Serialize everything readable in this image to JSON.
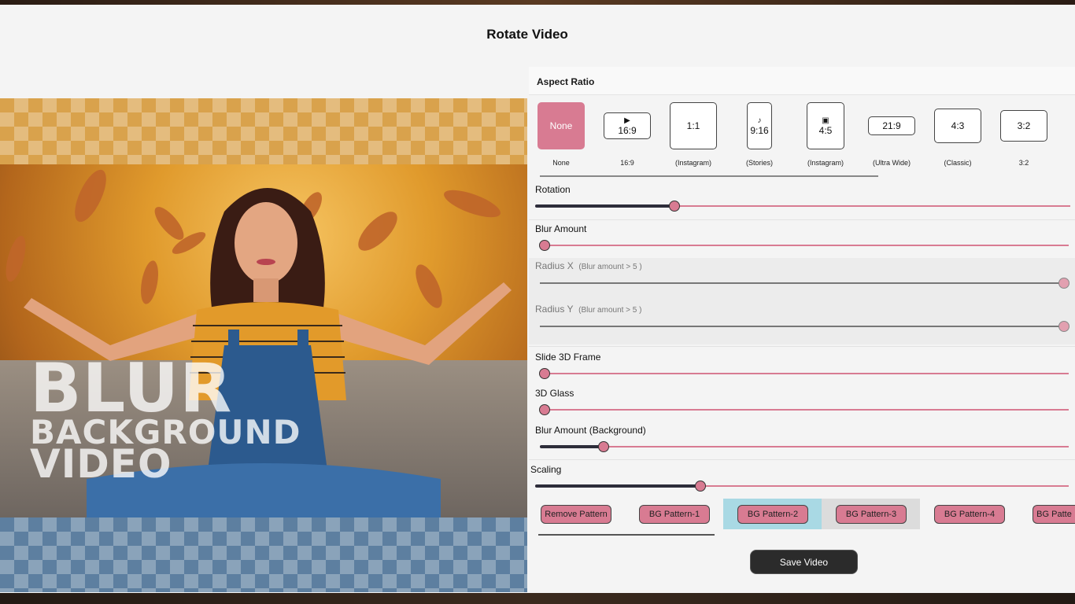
{
  "window": {
    "title": "Rotate Video"
  },
  "preview": {
    "overlay_line1": "BLUR",
    "overlay_line2": "BACKGROUND",
    "overlay_line3": "VIDEO"
  },
  "aspect": {
    "heading": "Aspect Ratio",
    "items": [
      {
        "box_label": "None",
        "caption": "None",
        "icon": "",
        "selected": true
      },
      {
        "box_label": "16:9",
        "caption": "16:9",
        "icon": "youtube-icon"
      },
      {
        "box_label": "1:1",
        "caption": "(Instagram)",
        "icon": ""
      },
      {
        "box_label": "9:16",
        "caption": "(Stories)",
        "icon": "tiktok-icon"
      },
      {
        "box_label": "4:5",
        "caption": "(Instagram)",
        "icon": "instagram-icon"
      },
      {
        "box_label": "21:9",
        "caption": "(Ultra Wide)",
        "icon": ""
      },
      {
        "box_label": "4:3",
        "caption": "(Classic)",
        "icon": ""
      },
      {
        "box_label": "3:2",
        "caption": "3:2",
        "icon": ""
      }
    ]
  },
  "controls": {
    "rotation": {
      "label": "Rotation",
      "value": 0.26
    },
    "blur_amount": {
      "label": "Blur Amount",
      "value": 0.0
    },
    "radius_x": {
      "label": "Radius X",
      "hint": "(Blur amount > 5 )",
      "value": 1.0
    },
    "radius_y": {
      "label": "Radius Y",
      "hint": "(Blur amount > 5 )",
      "value": 1.0
    },
    "slide_3d": {
      "label": "Slide 3D Frame",
      "value": 0.0
    },
    "glass_3d": {
      "label": "3D Glass",
      "value": 0.0
    },
    "blur_bg": {
      "label": "Blur Amount (Background)",
      "value": 0.12
    },
    "scaling": {
      "label": "Scaling",
      "value": 0.31
    }
  },
  "patterns": {
    "buttons": [
      "Remove Pattern",
      "BG Pattern-1",
      "BG Pattern-2",
      "BG Pattern-3",
      "BG Pattern-4",
      "BG Patte"
    ],
    "selected_index": 2,
    "hover_index": 3,
    "selected_color": "#a9d9e4",
    "hover_color": "#dcdcdc"
  },
  "save_label": "Save Video",
  "colors": {
    "accent": "#d87b92",
    "fill": "#2d2d3a"
  }
}
